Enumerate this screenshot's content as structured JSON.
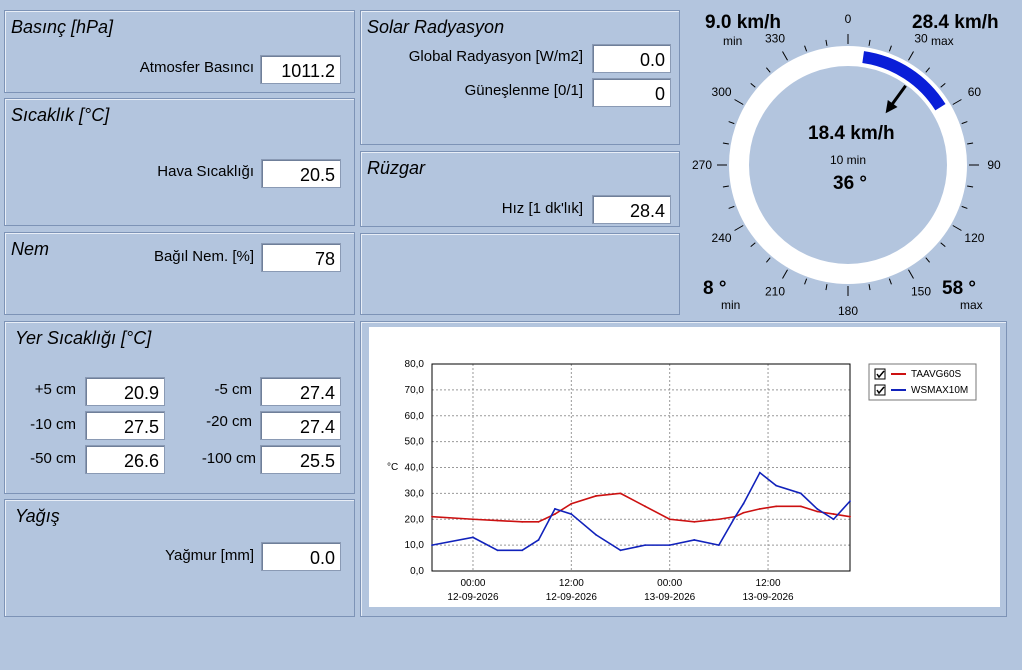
{
  "pressure": {
    "title": "Basınç [hPa]",
    "label": "Atmosfer Basıncı",
    "value": "1011.2"
  },
  "temperature": {
    "title": "Sıcaklık [°C]",
    "label": "Hava Sıcaklığı",
    "value": "20.5"
  },
  "humidity": {
    "title": "Nem",
    "label": "Bağıl Nem. [%]",
    "value": "78"
  },
  "solar": {
    "title": "Solar Radyasyon",
    "global_label": "Global Radyasyon [W/m2]",
    "global_value": "0.0",
    "sunshine_label": "Güneşlenme [0/1]",
    "sunshine_value": "0"
  },
  "wind": {
    "title": "Rüzgar",
    "speed_label": "Hız [1 dk'lık]",
    "speed_value": "28.4"
  },
  "ground": {
    "title": "Yer Sıcaklığı [°C]",
    "rows": [
      {
        "label": "+5 cm",
        "value": "20.9"
      },
      {
        "label": "-5 cm",
        "value": "27.4"
      },
      {
        "label": "-10 cm",
        "value": "27.5"
      },
      {
        "label": "-20 cm",
        "value": "27.4"
      },
      {
        "label": "-50 cm",
        "value": "26.6"
      },
      {
        "label": "-100 cm",
        "value": "25.5"
      }
    ]
  },
  "rain": {
    "title": "Yağış",
    "label": "Yağmur [mm]",
    "value": "0.0"
  },
  "gauge": {
    "min_speed": "9.0 km/h",
    "min_speed_caption": "min",
    "max_speed": "28.4 km/h",
    "max_speed_caption": "max",
    "current_speed": "18.4 km/h",
    "avg_caption": "10 min",
    "direction": "36 °",
    "min_dir": "8 °",
    "min_dir_caption": "min",
    "max_dir": "58 °",
    "max_dir_caption": "max",
    "compass_labels": [
      "0",
      "30",
      "60",
      "90",
      "120",
      "150",
      "180",
      "210",
      "240",
      "270",
      "300",
      "330"
    ],
    "arrow_direction_deg": 36,
    "dir_range_deg": [
      8,
      58
    ],
    "range_color": "#0a1ed8"
  },
  "chart_data": {
    "type": "line",
    "ylabel": "°C",
    "ylim": [
      0,
      80
    ],
    "yticks": [
      "80,0",
      "70,0",
      "60,0",
      "50,0",
      "40,0",
      "30,0",
      "20,0",
      "10,0",
      "0,0"
    ],
    "xticks": [
      {
        "time": "00:00",
        "date": "12-09-2026"
      },
      {
        "time": "12:00",
        "date": "12-09-2026"
      },
      {
        "time": "00:00",
        "date": "13-09-2026"
      },
      {
        "time": "12:00",
        "date": "13-09-2026"
      }
    ],
    "grid": true,
    "legend_position": "top-right",
    "x_hours": [
      -5,
      0,
      3,
      6,
      8,
      10,
      12,
      15,
      18,
      21,
      24,
      27,
      30,
      32,
      33,
      35,
      37,
      40,
      42,
      44,
      46
    ],
    "series": [
      {
        "name": "TAAVG60S",
        "color": "#cc1111",
        "checked": true,
        "values": [
          21,
          20,
          19.5,
          19,
          19,
          22,
          26,
          29,
          30,
          25,
          20,
          19,
          20,
          21,
          22.5,
          24,
          25,
          25,
          23,
          22,
          21
        ]
      },
      {
        "name": "WSMAX10M",
        "color": "#1122bb",
        "checked": true,
        "values": [
          10,
          13,
          8,
          8,
          12,
          24,
          22,
          14,
          8,
          10,
          10,
          12,
          10,
          21,
          26,
          38,
          33,
          30,
          24,
          20,
          27
        ]
      }
    ]
  }
}
